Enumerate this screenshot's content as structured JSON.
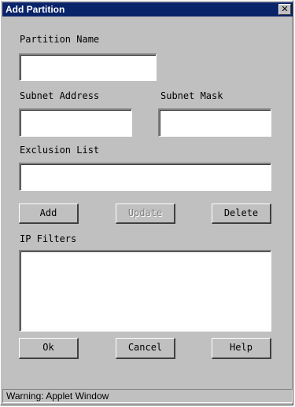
{
  "window": {
    "title": "Add Partition",
    "close_glyph": "✕"
  },
  "form": {
    "partition_name_label": "Partition Name",
    "partition_name_value": "",
    "subnet_address_label": "Subnet Address",
    "subnet_address_value": "",
    "subnet_mask_label": "Subnet Mask",
    "subnet_mask_value": "",
    "exclusion_list_label": "Exclusion List",
    "exclusion_list_value": "",
    "ip_filters_label": "IP Filters",
    "ip_filters_value": ""
  },
  "buttons": {
    "add": "Add",
    "update": "Update",
    "delete": "Delete",
    "ok": "Ok",
    "cancel": "Cancel",
    "help": "Help"
  },
  "status": {
    "text": "Warning: Applet Window"
  },
  "icons": {
    "close": "close-icon"
  },
  "colors": {
    "titlebar": "#0a246a",
    "face": "#c0c0c0",
    "disabled_text": "#808080"
  }
}
